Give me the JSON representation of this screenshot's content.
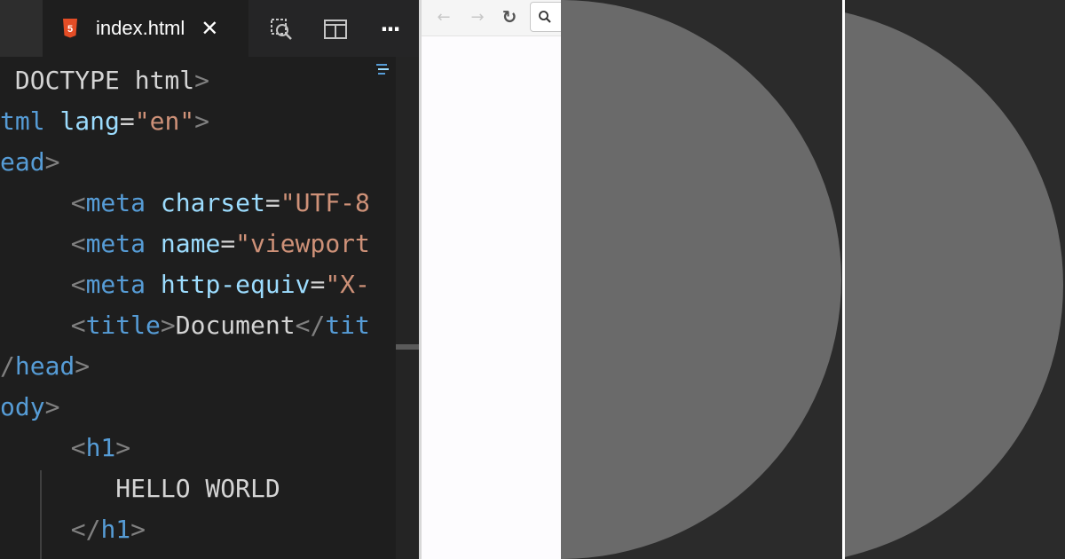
{
  "editor": {
    "tab": {
      "filename": "index.html",
      "close_glyph": "✕",
      "file_icon": "html5-icon"
    },
    "toolbar": {
      "icons": [
        "open-preview-icon",
        "split-editor-icon",
        "more-actions-icon"
      ],
      "more_glyph": "···"
    },
    "code_lines": [
      {
        "id": "doctype",
        "tokens": [
          [
            "t-text",
            " DOCTYPE html"
          ],
          [
            "t-punc",
            ">"
          ]
        ]
      },
      {
        "id": "html",
        "tokens": [
          [
            "t-tag",
            "tml "
          ],
          [
            "t-attr",
            "lang"
          ],
          [
            "t-text",
            "="
          ],
          [
            "t-str",
            "\"en\""
          ],
          [
            "t-punc",
            ">"
          ]
        ]
      },
      {
        "id": "head-open",
        "tokens": [
          [
            "t-tag",
            "ead"
          ],
          [
            "t-punc",
            ">"
          ]
        ]
      },
      {
        "id": "meta-charset",
        "tokens": [
          [
            "t-text",
            "  "
          ],
          [
            "t-punc",
            "<"
          ],
          [
            "t-tag",
            "meta "
          ],
          [
            "t-attr",
            "charset"
          ],
          [
            "t-text",
            "="
          ],
          [
            "t-str",
            "\"UTF-8"
          ]
        ]
      },
      {
        "id": "meta-viewport",
        "tokens": [
          [
            "t-text",
            "  "
          ],
          [
            "t-punc",
            "<"
          ],
          [
            "t-tag",
            "meta "
          ],
          [
            "t-attr",
            "name"
          ],
          [
            "t-text",
            "="
          ],
          [
            "t-str",
            "\"viewport"
          ]
        ]
      },
      {
        "id": "meta-http-equiv",
        "tokens": [
          [
            "t-text",
            "  "
          ],
          [
            "t-punc",
            "<"
          ],
          [
            "t-tag",
            "meta "
          ],
          [
            "t-attr",
            "http-equiv"
          ],
          [
            "t-text",
            "="
          ],
          [
            "t-str",
            "\"X-"
          ]
        ]
      },
      {
        "id": "title",
        "tokens": [
          [
            "t-text",
            "  "
          ],
          [
            "t-punc",
            "<"
          ],
          [
            "t-tag",
            "title"
          ],
          [
            "t-punc",
            ">"
          ],
          [
            "t-text",
            "Document"
          ],
          [
            "t-punc",
            "</"
          ],
          [
            "t-tag",
            "tit"
          ]
        ]
      },
      {
        "id": "head-close",
        "tokens": [
          [
            "t-punc",
            "/"
          ],
          [
            "t-tag",
            "head"
          ],
          [
            "t-punc",
            ">"
          ]
        ]
      },
      {
        "id": "body-open",
        "tokens": [
          [
            "t-tag",
            "ody"
          ],
          [
            "t-punc",
            ">"
          ]
        ]
      },
      {
        "id": "h1-open",
        "tokens": [
          [
            "t-text",
            "  "
          ],
          [
            "t-punc",
            "<"
          ],
          [
            "t-tag",
            "h1"
          ],
          [
            "t-punc",
            ">"
          ]
        ]
      },
      {
        "id": "h1-text",
        "tokens": [
          [
            "t-text",
            "     HELLO WORLD"
          ]
        ]
      },
      {
        "id": "h1-close",
        "tokens": [
          [
            "t-text",
            "  "
          ],
          [
            "t-punc",
            "</"
          ],
          [
            "t-tag",
            "h1"
          ],
          [
            "t-punc",
            ">"
          ]
        ]
      }
    ]
  },
  "browser": {
    "back_glyph": "←",
    "forward_glyph": "→",
    "reload_glyph": "↻",
    "search_icon": "search-icon"
  },
  "colors": {
    "editor_bg": "#1e1e1e",
    "tag": "#569cd6",
    "attribute": "#9cdcfe",
    "string": "#ce9178",
    "text": "#d4d4d4",
    "html5_orange": "#e44d26",
    "panel_bg": "#2b2b2b",
    "circle": "#6a6a6a"
  }
}
